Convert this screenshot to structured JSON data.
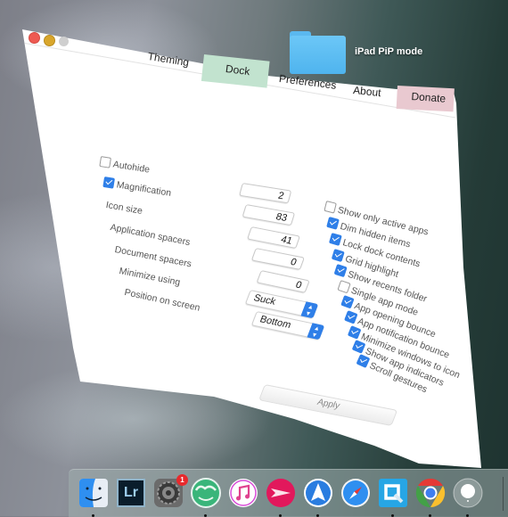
{
  "desktop": {
    "folder_label": "iPad PiP mode"
  },
  "window": {
    "traffic_lights": {
      "close": "#ee5a52",
      "minimize": "#d9a62b",
      "zoom": "#cfcfcf"
    },
    "tabs": [
      {
        "label": "Theming",
        "active": false
      },
      {
        "label": "Dock",
        "active": true,
        "color": "#c2e3cf"
      },
      {
        "label": "Preferences",
        "active": false
      },
      {
        "label": "About",
        "active": false
      },
      {
        "label": "Donate",
        "active": false,
        "color": "#e9c9d0"
      }
    ],
    "left_options": {
      "autohide": {
        "label": "Autohide",
        "checked": false
      },
      "magnification": {
        "label": "Magnification",
        "checked": true,
        "value": "2"
      },
      "icon_size": {
        "label": "Icon size",
        "value": "83"
      },
      "application_spacers": {
        "label": "Application spacers",
        "value": "41"
      },
      "document_spacers": {
        "label": "Document spacers",
        "value": "0"
      },
      "minimize_using": {
        "label": "Minimize using",
        "value": "0",
        "select": "Suck"
      },
      "position_on_screen": {
        "label": "Position on screen",
        "select": "Bottom"
      }
    },
    "right_options": [
      {
        "label": "Show only active apps",
        "checked": false
      },
      {
        "label": "Dim hidden items",
        "checked": true
      },
      {
        "label": "Lock dock contents",
        "checked": true
      },
      {
        "label": "Grid highlight",
        "checked": true
      },
      {
        "label": "Show recents folder",
        "checked": true
      },
      {
        "label": "Single app mode",
        "checked": false
      },
      {
        "label": "App opening bounce",
        "checked": true
      },
      {
        "label": "App notification bounce",
        "checked": true
      },
      {
        "label": "Minimize windows to icon",
        "checked": true
      },
      {
        "label": "Show app indicators",
        "checked": true
      },
      {
        "label": "Scroll gestures",
        "checked": true
      }
    ],
    "apply_label": "Apply"
  },
  "dock": {
    "items": [
      {
        "name": "finder",
        "running": true
      },
      {
        "name": "lightroom",
        "label": "Lr",
        "running": false
      },
      {
        "name": "system-preferences",
        "badge": "1",
        "running": false
      },
      {
        "name": "palm-app",
        "running": true
      },
      {
        "name": "itunes",
        "running": false
      },
      {
        "name": "airmail",
        "running": true
      },
      {
        "name": "spark",
        "running": true
      },
      {
        "name": "safari",
        "running": false
      },
      {
        "name": "quip",
        "running": true
      },
      {
        "name": "chrome",
        "running": true
      },
      {
        "name": "siri-or-ball-app",
        "running": true
      }
    ]
  }
}
